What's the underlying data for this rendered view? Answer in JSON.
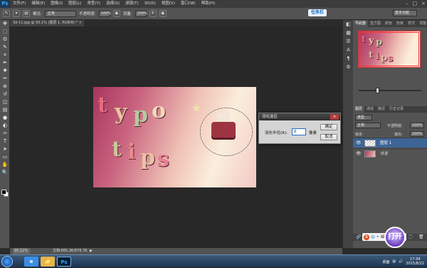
{
  "app": {
    "logo": "Ps",
    "menu": [
      "文件(F)",
      "编辑(E)",
      "图像(I)",
      "图层(L)",
      "类型(Y)",
      "选择(S)",
      "滤镜(T)",
      "3D(D)",
      "视图(V)",
      "窗口(W)",
      "帮助(H)"
    ],
    "window_controls": [
      "–",
      "□",
      "×"
    ]
  },
  "options_bar": {
    "mode_label": "模式:",
    "mode_value": "正常",
    "opacity_label": "不透明度:",
    "opacity_value": "100%",
    "flow_label": "流量:",
    "flow_value": "100%",
    "brand": "任务栏",
    "workspace": "基本功能"
  },
  "toolbar": {
    "tools": [
      "move",
      "marquee",
      "lasso",
      "quick-select",
      "crop",
      "eyedropper",
      "healing",
      "brush",
      "clone",
      "history-brush",
      "eraser",
      "gradient",
      "blur",
      "dodge",
      "pen",
      "type",
      "path-select",
      "shape",
      "hand",
      "zoom"
    ],
    "tool_glyphs": [
      "✥",
      "⬚",
      "ʘ",
      "✎",
      "⌗",
      "✒",
      "✚",
      "✏",
      "⊛",
      "↺",
      "◫",
      "▤",
      "●",
      "◐",
      "✑",
      "T",
      "➤",
      "▭",
      "✋",
      "🔍"
    ],
    "fg_color": "#000000",
    "bg_color": "#ffffff"
  },
  "document": {
    "tab_title": "3d-11.jpg @ 95.1% (图层 1, RGB/8) *",
    "close": "×",
    "artwork_letters": [
      "t",
      "y",
      "p",
      "o",
      "t",
      "i",
      "p",
      "s"
    ]
  },
  "dialog": {
    "title": "羽化选区",
    "close": "×",
    "radius_label": "羽化半径(R):",
    "radius_value": "0",
    "unit": "像素",
    "ok_label": "确定",
    "cancel_label": "取消"
  },
  "statusbar": {
    "zoom": "95.12%",
    "doc_info": "文档:665.2K/676.7K",
    "arrow": "▶"
  },
  "right_panel": {
    "top_tabs": [
      "导航器",
      "直方图",
      "颜色",
      "色板",
      "样式",
      "调整"
    ],
    "nav_letters": [
      "t",
      "y",
      "p",
      "t",
      "i",
      "p",
      "s"
    ],
    "zoom_level_fraction": 0.3,
    "layer_tabs": [
      "图层",
      "通道",
      "路径",
      "历史记录"
    ],
    "filter_label": "类型",
    "blend_mode": "正常",
    "opacity_label": "不透明度:",
    "opacity_value": "100%",
    "lock_label": "锁定:",
    "fill_label": "填充:",
    "fill_value": "100%",
    "layers": [
      {
        "name": "图层 1",
        "selected": true
      },
      {
        "name": "背景",
        "selected": false
      }
    ],
    "footer_icons": [
      "🔗",
      "fx",
      "◐",
      "◑",
      "📁",
      "🗋",
      "🗑"
    ]
  },
  "panel_icons": [
    "◧",
    "▦",
    "☰",
    "A",
    "¶",
    "⚙"
  ],
  "ime": {
    "logo": "S",
    "text": "中",
    "extras": [
      "•",
      "⌨",
      "✂"
    ]
  },
  "avatar_text": "打开",
  "taskbar": {
    "apps": [
      {
        "label": "e",
        "color": "#3a8ee6"
      },
      {
        "label": "📁",
        "color": "#e7b54c"
      },
      {
        "label": "Ps",
        "color": "#001e36"
      }
    ],
    "tray_label": "桌面",
    "time": "17:34",
    "date": "2015/8/22"
  }
}
